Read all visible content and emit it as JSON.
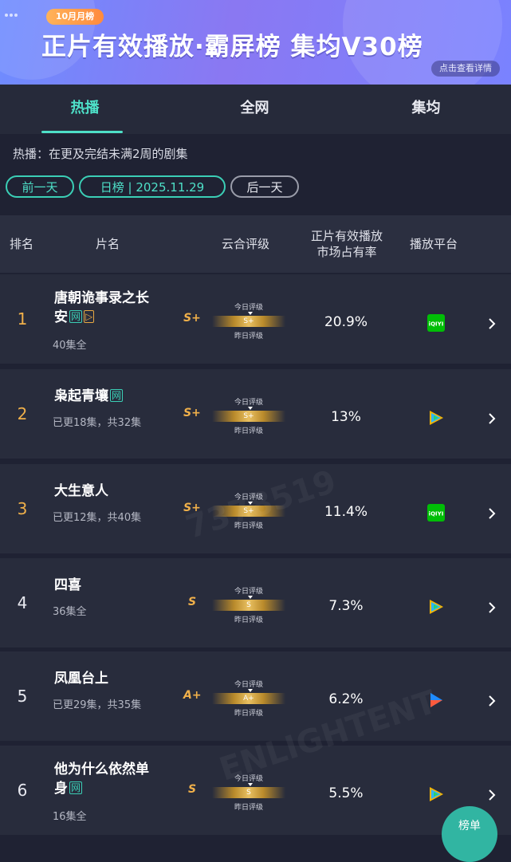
{
  "banner": {
    "month_badge": "10月月榜",
    "title": "正片有效播放·霸屏榜 集均V30榜",
    "detail_button": "点击查看详情"
  },
  "tabs": [
    {
      "label": "热播",
      "active": true
    },
    {
      "label": "全网",
      "active": false
    },
    {
      "label": "集均",
      "active": false
    }
  ],
  "description": "热播：在更及完结未满2周的剧集",
  "date_nav": {
    "prev": "前一天",
    "current": "日榜 | 2025.11.29",
    "next": "后一天"
  },
  "table_header": {
    "rank": "排名",
    "title": "片名",
    "rating": "云合评级",
    "share_line1": "正片有效播放",
    "share_line2": "市场占有率",
    "platform": "播放平台"
  },
  "grade_labels": {
    "today": "今日评级",
    "yesterday": "昨日评级"
  },
  "rows": [
    {
      "rank": "1",
      "title_line1": "唐朝诡事录之长",
      "title_line2": "安",
      "tags": [
        "网",
        "play"
      ],
      "episodes": "40集全",
      "grade": "S+",
      "bar_grade": "S+",
      "share": "20.9%",
      "platform_icon": "iqiyi-icon",
      "rank_color": "#f0b04a"
    },
    {
      "rank": "2",
      "title_line1": "枭起青壤",
      "title_line2": "",
      "tags": [
        "网"
      ],
      "episodes": "已更18集，共32集",
      "grade": "S+",
      "bar_grade": "S+",
      "share": "13%",
      "platform_icon": "tencent-video-icon",
      "rank_color": "#f0b04a"
    },
    {
      "rank": "3",
      "title_line1": "大生意人",
      "title_line2": "",
      "tags": [],
      "episodes": "已更12集，共40集",
      "grade": "S+",
      "bar_grade": "S+",
      "share": "11.4%",
      "platform_icon": "iqiyi-icon",
      "rank_color": "#f0b04a"
    },
    {
      "rank": "4",
      "title_line1": "四喜",
      "title_line2": "",
      "tags": [],
      "episodes": "36集全",
      "grade": "S",
      "bar_grade": "S",
      "share": "7.3%",
      "platform_icon": "tencent-video-icon",
      "rank_color": "#e8e9f0"
    },
    {
      "rank": "5",
      "title_line1": "凤凰台上",
      "title_line2": "",
      "tags": [],
      "episodes": "已更29集，共35集",
      "grade": "A+",
      "bar_grade": "A+",
      "share": "6.2%",
      "platform_icon": "youku-icon",
      "rank_color": "#e8e9f0"
    },
    {
      "rank": "6",
      "title_line1": "他为什么依然单",
      "title_line2": "身",
      "tags": [
        "网"
      ],
      "episodes": "16集全",
      "grade": "S",
      "bar_grade": "S",
      "share": "5.5%",
      "platform_icon": "tencent-video-icon",
      "rank_color": "#e8e9f0"
    }
  ],
  "platform_labels": {
    "iqiyi": "iQIYI"
  },
  "fab_label": "榜单",
  "colors": {
    "accent": "#4ee0c8",
    "gold": "#f0b04a",
    "background": "#1f2233",
    "iqiyi": "#00be06",
    "tencent": "#2fb4ff",
    "youku": "#1f8bff"
  }
}
